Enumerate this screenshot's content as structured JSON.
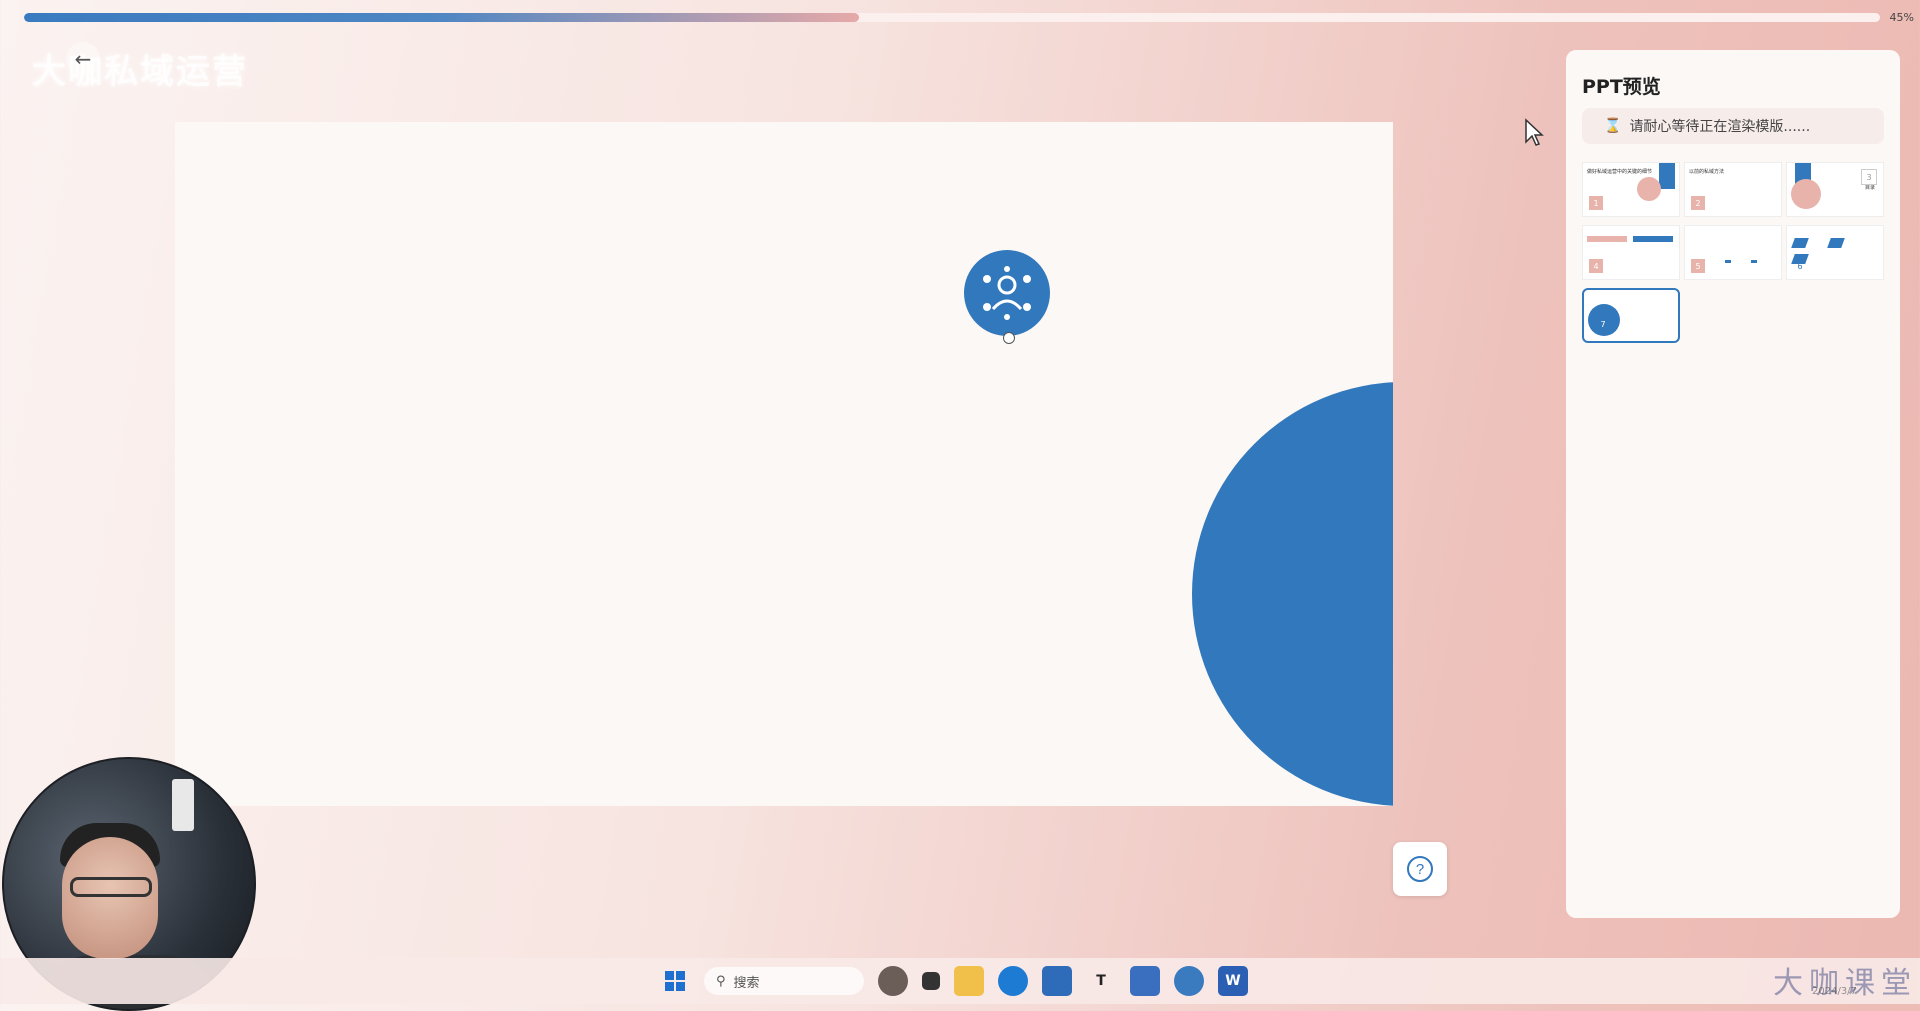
{
  "progress": {
    "value_percent": 45,
    "label": "45%"
  },
  "header": {
    "brand_title": "大咖私域运营"
  },
  "slide": {
    "accent_color": "#3278bd"
  },
  "preview": {
    "title": "PPT预览",
    "status_text": "请耐心等待正在渲染模版......",
    "thumbnails": [
      {
        "num": "1",
        "text": "做好私域运营中的关键的细节"
      },
      {
        "num": "2",
        "text": "以前的私域方法"
      },
      {
        "num": "3",
        "text": "目录"
      },
      {
        "num": "4",
        "text": ""
      },
      {
        "num": "5",
        "text": ""
      },
      {
        "num": "6",
        "text": ""
      },
      {
        "num": "7",
        "text": ""
      }
    ],
    "selected_index": 6
  },
  "help": {
    "icon": "question-icon"
  },
  "taskbar": {
    "search_label": "搜索"
  },
  "watermark": {
    "text": "大咖课堂",
    "date": "2024/3/7"
  }
}
